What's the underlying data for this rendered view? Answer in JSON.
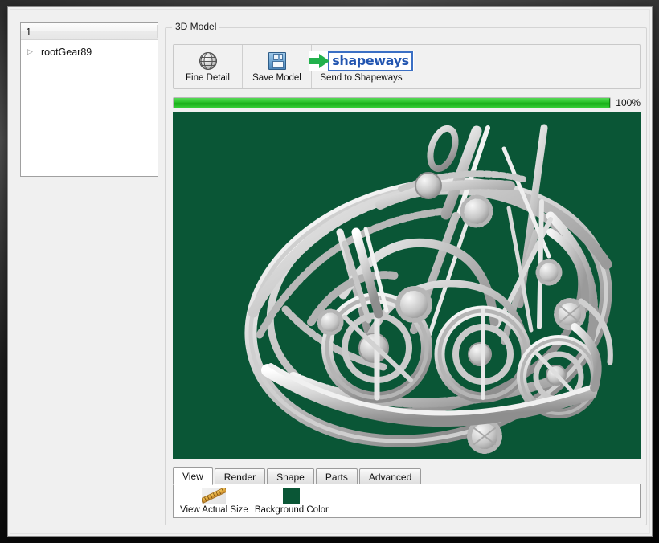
{
  "window": {
    "tree_panel": {
      "column_header": "1",
      "items": [
        {
          "label": "rootGear89",
          "expander": "collapsed-arrow-icon"
        }
      ]
    },
    "model_group": {
      "title": "3D Model",
      "toolbar": {
        "buttons": [
          {
            "label": "Fine Detail",
            "icon": "globe-icon"
          },
          {
            "label": "Save Model",
            "icon": "floppy-disk-icon"
          },
          {
            "label": "Send to Shapeways",
            "icon": "shapeways-logo-icon",
            "logo_word": "shapeways"
          }
        ]
      },
      "progress": {
        "value": 100,
        "text": "100%",
        "fill_color": "#22c72f"
      },
      "viewport": {
        "background_color": "#0a5636",
        "model_color": "#d8d8d8",
        "content": "3d-gear-assembly"
      },
      "tabs": [
        {
          "label": "View",
          "active": true
        },
        {
          "label": "Render",
          "active": false
        },
        {
          "label": "Shape",
          "active": false
        },
        {
          "label": "Parts",
          "active": false
        },
        {
          "label": "Advanced",
          "active": false
        }
      ],
      "view_tab_items": [
        {
          "label": "View Actual Size",
          "icon": "ruler-icon"
        },
        {
          "label": "Background Color",
          "icon": "color-swatch-icon",
          "color": "#0a5636"
        }
      ]
    }
  }
}
